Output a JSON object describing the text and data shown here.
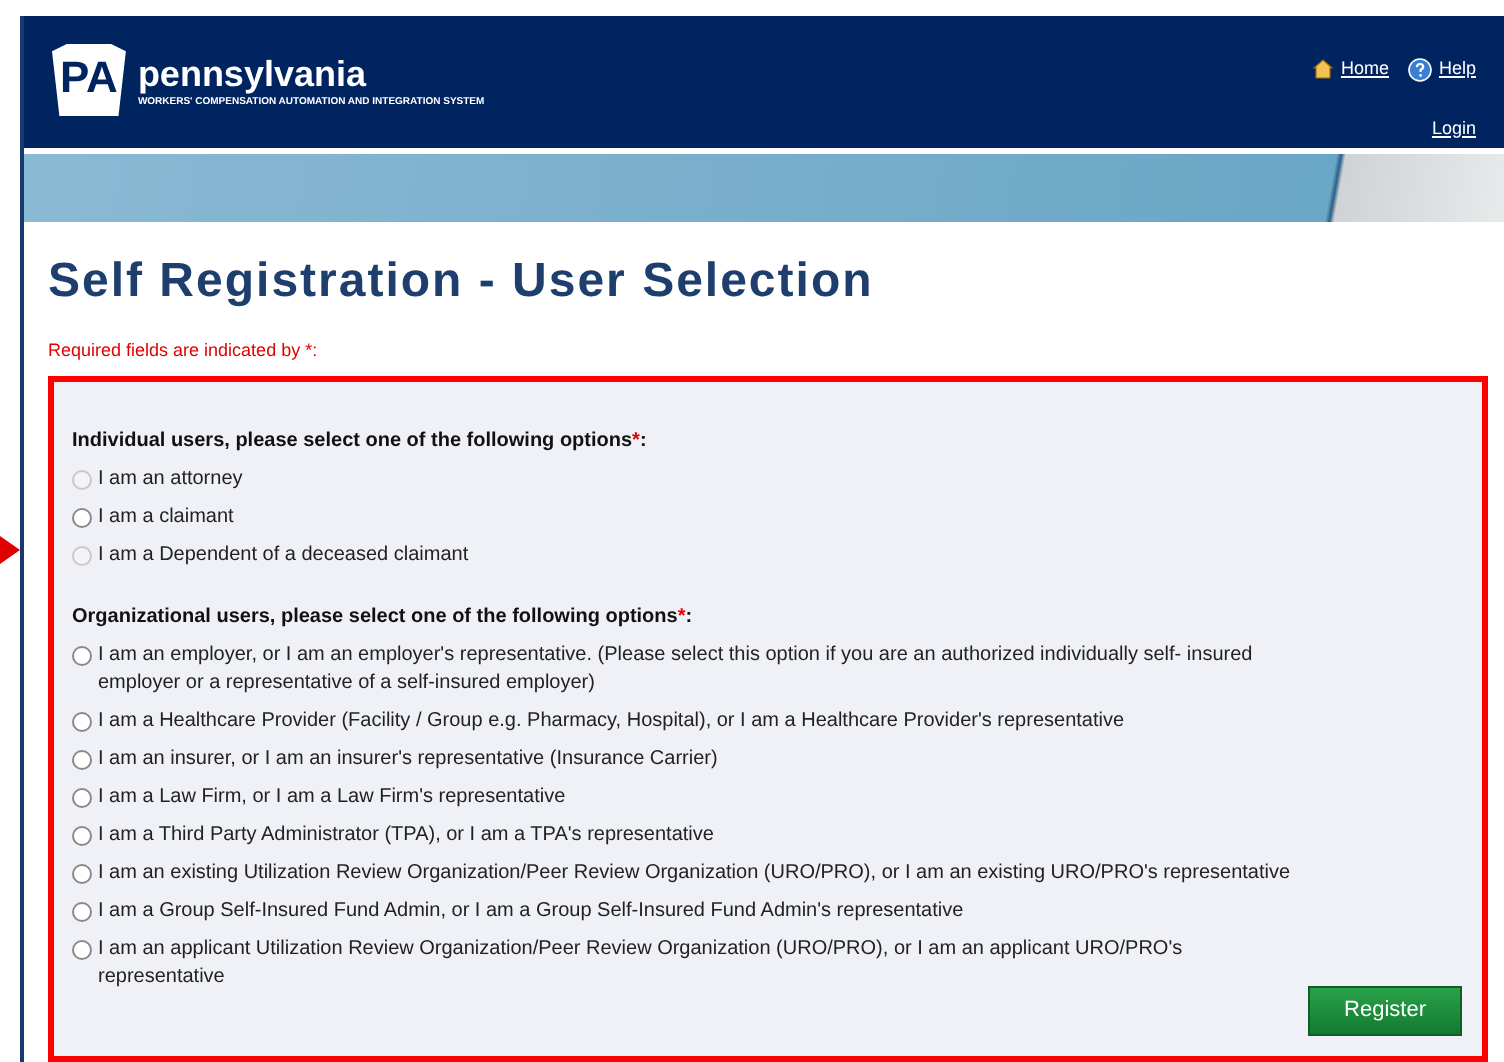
{
  "header": {
    "logo_badge": "PA",
    "logo_name": "pennsylvania",
    "subtitle": "WORKERS' COMPENSATION AUTOMATION AND INTEGRATION SYSTEM",
    "links": [
      {
        "kind": "home",
        "label": "Home"
      },
      {
        "kind": "help",
        "label": "Help"
      }
    ],
    "login": "Login"
  },
  "title": "Self Registration - User Selection",
  "required_note": "Required fields are indicated by *:",
  "groups": [
    {
      "heading": "Individual users, please select one of the following options",
      "mark": "*",
      "suffix": ":",
      "options": [
        {
          "label": "I am an attorney",
          "selected": false,
          "disabled": true
        },
        {
          "label": "I am a claimant",
          "selected": false,
          "disabled": false
        },
        {
          "label": "I am a Dependent of a deceased claimant",
          "selected": false,
          "disabled": true
        }
      ]
    },
    {
      "heading": "Organizational users, please select one of the following options",
      "mark": "*",
      "suffix": ":",
      "options": [
        {
          "label": "I am an employer, or I am an employer's representative. (Please select this option if you are an authorized individually self- insured employer or a representative of a self-insured employer)",
          "selected": false,
          "disabled": false
        },
        {
          "label": "I am a Healthcare Provider (Facility / Group e.g. Pharmacy, Hospital), or I am a Healthcare Provider's representative",
          "selected": false,
          "disabled": false
        },
        {
          "label": "I am an insurer, or I am an insurer's representative (Insurance Carrier)",
          "selected": false,
          "disabled": false
        },
        {
          "label": "I am a Law Firm, or I am a Law Firm's representative",
          "selected": false,
          "disabled": false
        },
        {
          "label": "I am a Third Party Administrator (TPA), or I am a TPA's representative",
          "selected": false,
          "disabled": false
        },
        {
          "label": "I am an existing Utilization Review Organization/Peer Review Organization (URO/PRO), or I am an existing URO/PRO's representative",
          "selected": false,
          "disabled": false
        },
        {
          "label": "I am a Group Self-Insured Fund Admin, or I am a Group Self-Insured Fund Admin's representative",
          "selected": false,
          "disabled": false
        },
        {
          "label": "I am an applicant Utilization Review Organization/Peer Review Organization (URO/PRO), or I am an applicant URO/PRO's representative",
          "selected": false,
          "disabled": false
        }
      ]
    }
  ],
  "register_button": "Register"
}
